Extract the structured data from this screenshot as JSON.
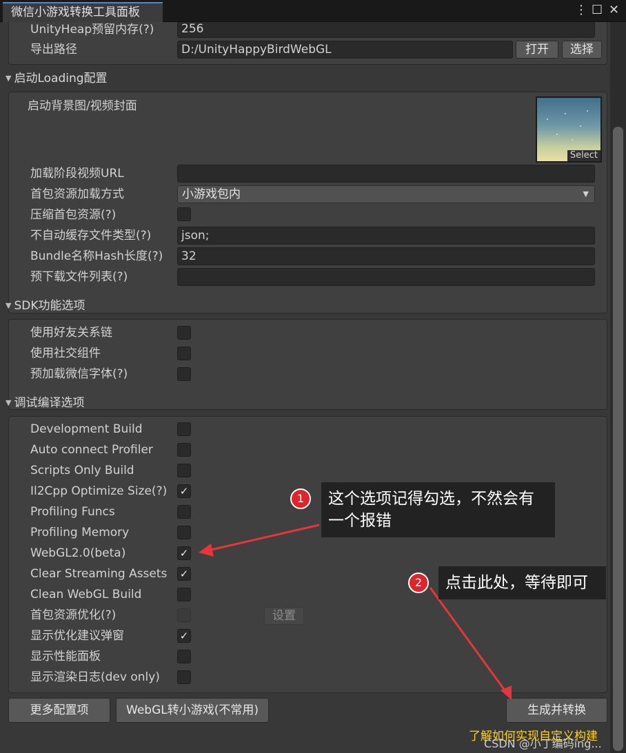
{
  "window": {
    "title": "微信小游戏转换工具面板",
    "menu_glyph": "⋮",
    "maximize_glyph": "☐",
    "close_glyph": "✕"
  },
  "basic": {
    "heap_label": "UnityHeap预留内存(?)",
    "heap_value": "256",
    "export_label": "导出路径",
    "export_value": "D:/UnityHappyBirdWebGL",
    "open_button": "打开",
    "select_button": "选择"
  },
  "loading": {
    "header": "启动Loading配置",
    "bg_label": "启动背景图/视频封面",
    "image_select": "Select",
    "video_url_label": "加载阶段视频URL",
    "video_url_value": "",
    "first_pkg_label": "首包资源加载方式",
    "first_pkg_value": "小游戏包内",
    "compress_label": "压缩首包资源(?)",
    "compress_checked": false,
    "nocache_label": "不自动缓存文件类型(?)",
    "nocache_value": "json;",
    "bundle_hash_label": "Bundle名称Hash长度(?)",
    "bundle_hash_value": "32",
    "preload_label": "预下载文件列表(?)",
    "preload_value": ""
  },
  "sdk": {
    "header": "SDK功能选项",
    "items": [
      {
        "label": "使用好友关系链",
        "checked": false
      },
      {
        "label": "使用社交组件",
        "checked": false
      },
      {
        "label": "预加载微信字体(?)",
        "checked": false
      }
    ]
  },
  "debug": {
    "header": "调试编译选项",
    "items": [
      {
        "label": "Development Build",
        "checked": false
      },
      {
        "label": "Auto connect Profiler",
        "checked": false
      },
      {
        "label": "Scripts Only Build",
        "checked": false
      },
      {
        "label": "Il2Cpp Optimize Size(?)",
        "checked": true
      },
      {
        "label": "Profiling Funcs",
        "checked": false
      },
      {
        "label": "Profiling Memory",
        "checked": false
      },
      {
        "label": "WebGL2.0(beta)",
        "checked": true
      },
      {
        "label": "Clear Streaming Assets",
        "checked": true
      },
      {
        "label": "Clean WebGL Build",
        "checked": false
      },
      {
        "label": "首包资源优化(?)",
        "checked": false
      },
      {
        "label": "显示优化建议弹窗",
        "checked": true
      },
      {
        "label": "显示性能面板",
        "checked": false
      },
      {
        "label": "显示渲染日志(dev only)",
        "checked": false
      }
    ],
    "settings_button": "设置"
  },
  "bottom": {
    "more_button": "更多配置项",
    "webgl_button": "WebGL转小游戏(不常用)",
    "build_button": "生成并转换",
    "custom_link": "了解如何实现自定义构建"
  },
  "annotations": {
    "marker1": "1",
    "callout1": "这个选项记得勾选，不然会有一个报错",
    "marker2": "2",
    "callout2": "点击此处，等待即可",
    "arrow_color": "#e8343a"
  },
  "watermark": "CSDN @小丁编码ing..."
}
